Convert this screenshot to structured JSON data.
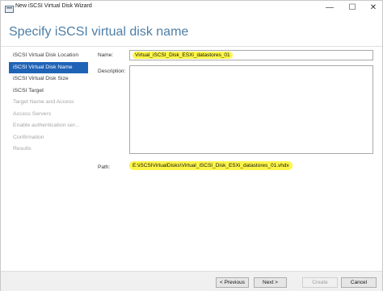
{
  "window": {
    "title": "New iSCSI Virtual Disk Wizard"
  },
  "header": {
    "title": "Specify iSCSI virtual disk name"
  },
  "steps": [
    {
      "label": "iSCSI Virtual Disk Location",
      "state": "completed"
    },
    {
      "label": "iSCSI Virtual Disk Name",
      "state": "active"
    },
    {
      "label": "iSCSI Virtual Disk Size",
      "state": "enabled"
    },
    {
      "label": "iSCSI Target",
      "state": "enabled"
    },
    {
      "label": "Target Name and Access",
      "state": "disabled"
    },
    {
      "label": "Access Servers",
      "state": "disabled"
    },
    {
      "label": "Enable authentication ser...",
      "state": "disabled"
    },
    {
      "label": "Confirmation",
      "state": "disabled"
    },
    {
      "label": "Results",
      "state": "disabled"
    }
  ],
  "form": {
    "name_label": "Name:",
    "name_value": "Virtual_iSCSI_Disk_ESXi_datastores_01",
    "description_label": "Description:",
    "description_value": "",
    "path_label": "Path:",
    "path_value": "E:\\iSCSIVirtualDisks\\Virtual_iSCSI_Disk_ESXi_datastores_01.vhdx"
  },
  "buttons": {
    "previous": "< Previous",
    "next": "Next >",
    "create": "Create",
    "cancel": "Cancel"
  },
  "colors": {
    "accent": "#1f63b7",
    "header": "#4d7fa7",
    "highlight": "#fdf64a"
  }
}
